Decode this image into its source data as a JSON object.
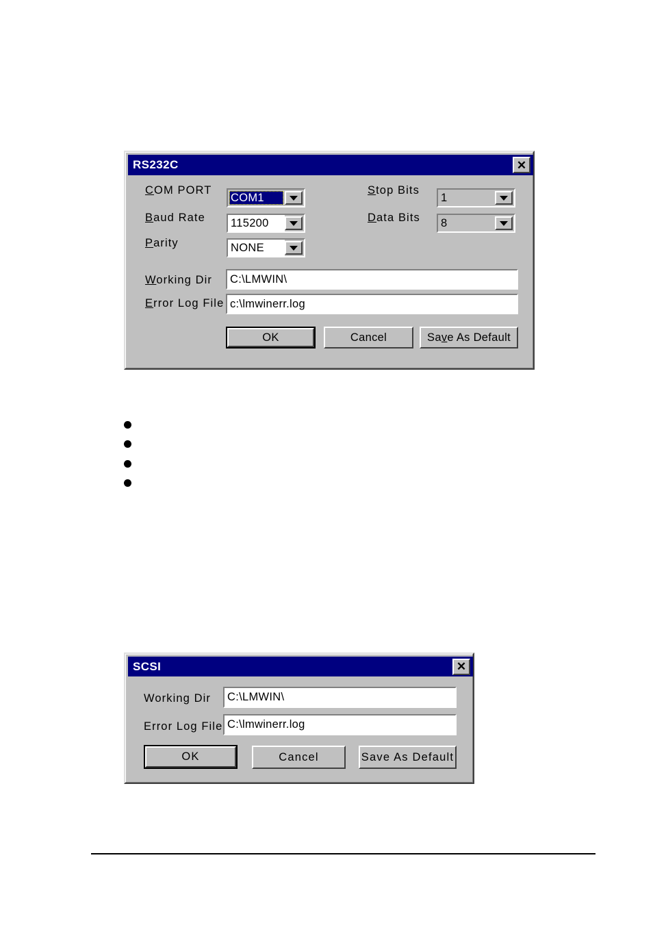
{
  "document": {
    "bullets": [
      "",
      "",
      "",
      ""
    ],
    "footer_rule": true
  },
  "rs232c_dialog": {
    "title": "RS232C",
    "close_label": "✕",
    "fields": {
      "com_port": {
        "label_prefix": "C",
        "label_rest": "OM PORT",
        "value": "COM1"
      },
      "baud_rate": {
        "label_prefix": "B",
        "label_rest": "aud Rate",
        "value": "115200"
      },
      "parity": {
        "label_prefix": "P",
        "label_rest": "arity",
        "value": "NONE"
      },
      "stop_bits": {
        "label_prefix": "S",
        "label_rest": "top Bits",
        "value": "1"
      },
      "data_bits": {
        "label_prefix": "D",
        "label_rest": "ata Bits",
        "value": "8"
      },
      "working_dir": {
        "label_prefix": "W",
        "label_rest": "orking Dir",
        "value": "C:\\LMWIN\\"
      },
      "error_log_file": {
        "label_prefix": "E",
        "label_rest": "rror Log File",
        "value": "c:\\lmwinerr.log"
      }
    },
    "buttons": {
      "ok": "OK",
      "cancel": "Cancel",
      "save_as_default_pre": "Sa",
      "save_as_default_accel": "v",
      "save_as_default_post": "e As Default"
    }
  },
  "scsi_dialog": {
    "title": "SCSI",
    "close_label": "✕",
    "fields": {
      "working_dir": {
        "label": "Working Dir",
        "value": "C:\\LMWIN\\"
      },
      "error_log_file": {
        "label": "Error Log File",
        "value": "C:\\lmwinerr.log"
      }
    },
    "buttons": {
      "ok": "OK",
      "cancel": "Cancel",
      "save_as_default": "Save As Default"
    }
  },
  "colors": {
    "titlebar": "#000080",
    "dialog_face": "#c0c0c0",
    "field_bg": "#ffffff",
    "selection_bg": "#000080",
    "focus_outline": "#e8e800"
  }
}
